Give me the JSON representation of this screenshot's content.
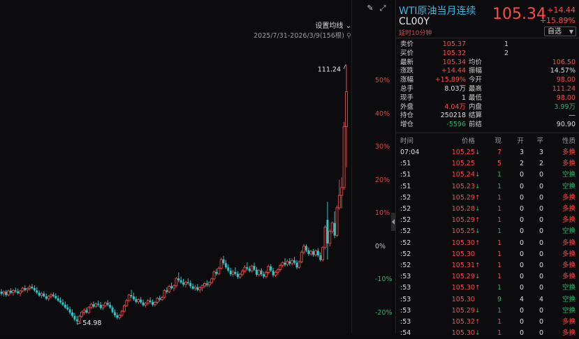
{
  "chart": {
    "toolbar": {
      "draw_icon": "pencil-icon",
      "fullscreen_icon": "fullscreen-icon"
    },
    "ma_setting_label": "设置均线",
    "date_range": "2025/7/31-2026/3/9(156根)",
    "pin_icon": "pin-icon",
    "y_ticks": [
      "50%",
      "40%",
      "30%",
      "20%",
      "10%",
      "0%",
      "-10%",
      "-20%"
    ],
    "high_label": "111.24",
    "low_label": "54.98",
    "colors": {
      "up": "#e04848",
      "down": "#2fc4c4"
    }
  },
  "chart_data": {
    "type": "candlestick",
    "date_range": "2025/7/31-2026/3/9",
    "count": 156,
    "ohlc": [
      [
        62.0,
        62.6,
        61.2,
        61.6
      ],
      [
        61.6,
        62.3,
        61.0,
        62.0
      ],
      [
        62.0,
        62.4,
        60.9,
        61.3
      ],
      [
        61.3,
        62.5,
        61.0,
        62.2
      ],
      [
        62.2,
        62.8,
        61.5,
        61.8
      ],
      [
        61.8,
        62.6,
        61.2,
        62.3
      ],
      [
        62.3,
        62.9,
        61.8,
        62.1
      ],
      [
        62.1,
        62.7,
        61.4,
        61.7
      ],
      [
        61.7,
        62.4,
        61.0,
        62.2
      ],
      [
        62.2,
        63.1,
        61.9,
        62.8
      ],
      [
        62.8,
        63.4,
        62.1,
        62.4
      ],
      [
        62.4,
        63.0,
        61.8,
        62.7
      ],
      [
        62.7,
        63.5,
        62.3,
        63.1
      ],
      [
        63.1,
        63.7,
        62.5,
        62.8
      ],
      [
        62.8,
        63.4,
        62.0,
        62.3
      ],
      [
        62.3,
        63.0,
        61.5,
        61.8
      ],
      [
        61.8,
        62.3,
        60.9,
        61.2
      ],
      [
        61.2,
        62.0,
        60.6,
        61.6
      ],
      [
        61.6,
        62.1,
        60.8,
        61.0
      ],
      [
        61.0,
        61.6,
        60.2,
        60.5
      ],
      [
        60.5,
        61.3,
        60.0,
        61.0
      ],
      [
        61.0,
        61.8,
        60.6,
        61.4
      ],
      [
        61.4,
        61.9,
        60.8,
        61.1
      ],
      [
        61.1,
        61.7,
        60.3,
        60.6
      ],
      [
        60.6,
        61.2,
        59.8,
        60.1
      ],
      [
        60.1,
        60.8,
        59.4,
        59.7
      ],
      [
        59.7,
        60.4,
        58.9,
        59.2
      ],
      [
        59.2,
        59.9,
        58.3,
        58.6
      ],
      [
        58.6,
        59.3,
        57.9,
        58.2
      ],
      [
        58.2,
        58.8,
        57.1,
        57.5
      ],
      [
        57.5,
        58.2,
        56.4,
        56.8
      ],
      [
        56.8,
        57.4,
        55.6,
        56.0
      ],
      [
        56.0,
        56.8,
        54.98,
        55.6
      ],
      [
        55.6,
        57.0,
        55.3,
        56.7
      ],
      [
        56.7,
        57.9,
        56.3,
        57.6
      ],
      [
        57.6,
        58.4,
        57.0,
        58.0
      ],
      [
        58.0,
        58.6,
        57.2,
        57.5
      ],
      [
        57.5,
        58.9,
        57.2,
        58.6
      ],
      [
        58.6,
        59.6,
        58.3,
        59.3
      ],
      [
        59.3,
        59.9,
        58.4,
        58.8
      ],
      [
        58.8,
        59.7,
        58.5,
        59.4
      ],
      [
        59.4,
        60.1,
        58.8,
        59.2
      ],
      [
        59.2,
        59.8,
        58.1,
        58.5
      ],
      [
        58.5,
        59.3,
        58.0,
        59.0
      ],
      [
        59.0,
        59.9,
        58.7,
        59.6
      ],
      [
        59.6,
        60.2,
        58.9,
        59.2
      ],
      [
        59.2,
        59.8,
        58.3,
        58.6
      ],
      [
        58.6,
        59.0,
        57.3,
        57.6
      ],
      [
        57.6,
        58.2,
        56.5,
        56.9
      ],
      [
        56.9,
        57.5,
        56.0,
        56.4
      ],
      [
        56.4,
        57.2,
        56.0,
        56.9
      ],
      [
        56.9,
        58.1,
        56.6,
        57.8
      ],
      [
        57.8,
        59.3,
        57.5,
        59.0
      ],
      [
        59.0,
        60.4,
        58.7,
        60.1
      ],
      [
        60.1,
        61.6,
        59.8,
        61.3
      ],
      [
        61.3,
        62.4,
        60.6,
        61.0
      ],
      [
        61.0,
        61.8,
        60.1,
        60.4
      ],
      [
        60.4,
        61.0,
        59.5,
        59.8
      ],
      [
        59.8,
        60.6,
        59.3,
        60.3
      ],
      [
        60.3,
        60.9,
        59.4,
        59.7
      ],
      [
        59.7,
        60.3,
        58.8,
        59.1
      ],
      [
        59.1,
        59.8,
        58.6,
        59.5
      ],
      [
        59.5,
        60.4,
        59.1,
        60.1
      ],
      [
        60.1,
        60.8,
        59.4,
        59.8
      ],
      [
        59.8,
        60.3,
        58.9,
        59.2
      ],
      [
        59.2,
        60.0,
        58.8,
        59.7
      ],
      [
        59.7,
        60.9,
        59.4,
        60.6
      ],
      [
        60.6,
        61.2,
        59.9,
        60.3
      ],
      [
        60.3,
        61.1,
        60.0,
        60.8
      ],
      [
        60.8,
        62.6,
        60.5,
        62.3
      ],
      [
        62.3,
        63.0,
        61.6,
        62.0
      ],
      [
        62.0,
        63.5,
        61.7,
        63.2
      ],
      [
        63.2,
        64.0,
        62.5,
        62.8
      ],
      [
        62.8,
        63.6,
        62.1,
        63.3
      ],
      [
        63.3,
        65.2,
        63.0,
        64.9
      ],
      [
        64.9,
        66.2,
        64.1,
        64.5
      ],
      [
        64.5,
        65.3,
        63.7,
        64.0
      ],
      [
        64.0,
        64.8,
        63.2,
        63.6
      ],
      [
        63.6,
        64.4,
        62.9,
        64.1
      ],
      [
        64.1,
        64.9,
        63.5,
        63.9
      ],
      [
        63.9,
        64.5,
        62.8,
        63.2
      ],
      [
        63.2,
        63.8,
        62.4,
        62.7
      ],
      [
        62.7,
        63.5,
        62.2,
        63.0
      ],
      [
        63.0,
        63.7,
        62.1,
        62.4
      ],
      [
        62.4,
        63.2,
        61.8,
        62.9
      ],
      [
        62.9,
        63.6,
        62.2,
        63.3
      ],
      [
        63.3,
        64.1,
        62.8,
        63.8
      ],
      [
        63.8,
        64.5,
        63.1,
        63.5
      ],
      [
        63.5,
        64.3,
        63.0,
        64.0
      ],
      [
        64.0,
        65.1,
        63.7,
        64.8
      ],
      [
        64.8,
        66.6,
        64.5,
        66.3
      ],
      [
        66.3,
        67.0,
        65.5,
        65.9
      ],
      [
        65.9,
        67.5,
        65.6,
        67.1
      ],
      [
        67.1,
        69.4,
        66.8,
        69.0
      ],
      [
        69.0,
        69.8,
        67.8,
        68.2
      ],
      [
        68.2,
        68.9,
        66.9,
        67.3
      ],
      [
        67.3,
        68.0,
        66.2,
        66.6
      ],
      [
        66.6,
        67.2,
        65.4,
        65.8
      ],
      [
        65.8,
        66.8,
        65.3,
        66.3
      ],
      [
        66.3,
        67.3,
        65.5,
        65.9
      ],
      [
        65.9,
        66.5,
        64.8,
        65.2
      ],
      [
        65.2,
        66.1,
        64.8,
        65.8
      ],
      [
        65.8,
        66.9,
        65.4,
        66.5
      ],
      [
        66.5,
        67.7,
        66.1,
        67.3
      ],
      [
        67.3,
        68.4,
        66.6,
        67.0
      ],
      [
        67.0,
        67.6,
        66.2,
        66.5
      ],
      [
        66.5,
        67.9,
        66.2,
        67.6
      ],
      [
        67.6,
        68.3,
        66.5,
        66.8
      ],
      [
        66.8,
        67.4,
        65.3,
        65.7
      ],
      [
        65.7,
        66.9,
        65.3,
        66.6
      ],
      [
        66.6,
        67.1,
        65.4,
        65.8
      ],
      [
        65.8,
        66.4,
        64.9,
        65.3
      ],
      [
        65.3,
        66.6,
        64.9,
        66.2
      ],
      [
        66.2,
        67.9,
        65.8,
        67.5
      ],
      [
        67.5,
        68.0,
        66.3,
        66.6
      ],
      [
        66.6,
        67.2,
        65.2,
        65.6
      ],
      [
        65.6,
        66.6,
        65.2,
        66.2
      ],
      [
        66.2,
        67.1,
        65.7,
        66.8
      ],
      [
        66.8,
        68.1,
        66.4,
        67.7
      ],
      [
        67.7,
        68.6,
        67.3,
        68.3
      ],
      [
        68.3,
        69.3,
        67.5,
        67.9
      ],
      [
        67.9,
        69.0,
        67.5,
        68.6
      ],
      [
        68.6,
        69.3,
        67.7,
        68.1
      ],
      [
        68.1,
        69.2,
        67.7,
        68.8
      ],
      [
        68.8,
        69.6,
        67.9,
        68.3
      ],
      [
        68.3,
        68.9,
        66.9,
        67.3
      ],
      [
        67.3,
        68.8,
        67.0,
        68.5
      ],
      [
        68.5,
        71.0,
        68.2,
        70.6
      ],
      [
        70.6,
        72.4,
        70.1,
        71.9
      ],
      [
        71.9,
        72.3,
        70.6,
        71.0
      ],
      [
        71.0,
        71.6,
        69.8,
        70.2
      ],
      [
        70.2,
        71.1,
        69.8,
        70.8
      ],
      [
        70.8,
        71.3,
        69.6,
        70.0
      ],
      [
        70.0,
        71.2,
        69.6,
        70.9
      ],
      [
        70.9,
        71.5,
        69.5,
        69.9
      ],
      [
        69.9,
        70.5,
        68.6,
        68.9
      ],
      [
        68.9,
        71.9,
        68.6,
        71.6
      ],
      [
        71.6,
        76.4,
        71.2,
        76.0
      ],
      [
        77.6,
        81.5,
        69.0,
        72.5
      ],
      [
        72.5,
        75.6,
        71.8,
        75.1
      ],
      [
        75.1,
        77.3,
        74.6,
        76.9
      ],
      [
        76.9,
        79.4,
        73.6,
        74.2
      ],
      [
        74.2,
        80.7,
        73.9,
        80.2
      ],
      [
        80.2,
        86.3,
        79.8,
        82.9
      ],
      [
        82.9,
        86.8,
        80.1,
        84.6
      ],
      [
        84.6,
        98.8,
        84.1,
        97.8
      ],
      [
        97.8,
        111.24,
        89.0,
        105.34
      ]
    ],
    "percent_axis_ticks": [
      "50%",
      "40%",
      "30%",
      "20%",
      "10%",
      "0%",
      "-10%",
      "-20%"
    ],
    "percent_base": 71.8,
    "ylim": [
      52.5,
      115
    ],
    "annotations": {
      "high": 111.24,
      "low": 54.98
    }
  },
  "panel": {
    "instrument_name": "WTI原油当月连续",
    "instrument_code": "CL00Y",
    "delay_note": "延时10分钟",
    "last_price": "105.34",
    "change_abs": "+14.44",
    "change_pct": "+15.89%",
    "watch_button": "自选",
    "quote": [
      {
        "label": "卖价",
        "value": "105.37",
        "value_color": "red",
        "qty": "1",
        "label2": "",
        "value2": "",
        "value2_color": "white"
      },
      {
        "label": "买价",
        "value": "105.32",
        "value_color": "red",
        "qty": "2",
        "label2": "",
        "value2": "",
        "value2_color": "white"
      },
      {
        "label": "最新",
        "value": "105.34",
        "value_color": "red",
        "qty": "",
        "label2": "均价",
        "value2": "106.50",
        "value2_color": "red"
      },
      {
        "label": "涨跌",
        "value": "+14.44",
        "value_color": "red",
        "qty": "",
        "label2": "振幅",
        "value2": "14.57%",
        "value2_color": "white"
      },
      {
        "label": "涨幅",
        "value": "+15.89%",
        "value_color": "red",
        "qty": "",
        "label2": "今开",
        "value2": "98.00",
        "value2_color": "red"
      },
      {
        "label": "总手",
        "value": "8.03万",
        "value_color": "white",
        "qty": "",
        "label2": "最高",
        "value2": "111.24",
        "value2_color": "red"
      },
      {
        "label": "现手",
        "value": "1",
        "value_color": "white",
        "qty": "",
        "label2": "最低",
        "value2": "98.00",
        "value2_color": "red"
      },
      {
        "label": "外盘",
        "value": "4.04万",
        "value_color": "red",
        "qty": "",
        "label2": "内盘",
        "value2": "3.99万",
        "value2_color": "green"
      },
      {
        "label": "持仓",
        "value": "250218",
        "value_color": "white",
        "qty": "",
        "label2": "结算",
        "value2": "—",
        "value2_color": "white"
      },
      {
        "label": "增仓",
        "value": "-5596",
        "value_color": "green",
        "qty": "",
        "label2": "前结",
        "value2": "90.90",
        "value2_color": "white"
      }
    ],
    "tick_headers": {
      "time": "时间",
      "price": "价格",
      "vol": "现",
      "open": "开",
      "close": "平",
      "nature": "性质"
    },
    "ticks": [
      {
        "time": "07:04",
        "price": "105.25",
        "dir": "down",
        "vol": "7",
        "open": "3",
        "close": "3",
        "nature": "多换",
        "nature_color": "red"
      },
      {
        "time": ":51",
        "price": "105.25",
        "dir": "",
        "vol": "5",
        "open": "2",
        "close": "2",
        "nature": "多换",
        "nature_color": "red"
      },
      {
        "time": ":51",
        "price": "105.24",
        "dir": "down",
        "vol": "1",
        "open": "0",
        "close": "0",
        "nature": "空换",
        "nature_color": "green"
      },
      {
        "time": ":51",
        "price": "105.23",
        "dir": "down",
        "vol": "1",
        "open": "0",
        "close": "0",
        "nature": "空换",
        "nature_color": "green"
      },
      {
        "time": ":52",
        "price": "105.29",
        "dir": "up",
        "vol": "1",
        "open": "0",
        "close": "0",
        "nature": "多换",
        "nature_color": "red"
      },
      {
        "time": ":52",
        "price": "105.28",
        "dir": "down",
        "vol": "1",
        "open": "0",
        "close": "0",
        "nature": "多换",
        "nature_color": "red"
      },
      {
        "time": ":52",
        "price": "105.29",
        "dir": "up",
        "vol": "1",
        "open": "0",
        "close": "0",
        "nature": "多换",
        "nature_color": "red"
      },
      {
        "time": ":52",
        "price": "105.25",
        "dir": "down",
        "vol": "1",
        "open": "0",
        "close": "0",
        "nature": "空换",
        "nature_color": "green"
      },
      {
        "time": ":52",
        "price": "105.30",
        "dir": "up",
        "vol": "1",
        "open": "0",
        "close": "0",
        "nature": "多换",
        "nature_color": "red"
      },
      {
        "time": ":52",
        "price": "105.30",
        "dir": "",
        "vol": "1",
        "open": "0",
        "close": "0",
        "nature": "多换",
        "nature_color": "red"
      },
      {
        "time": ":52",
        "price": "105.31",
        "dir": "up",
        "vol": "1",
        "open": "0",
        "close": "0",
        "nature": "多换",
        "nature_color": "red"
      },
      {
        "time": ":53",
        "price": "105.29",
        "dir": "down",
        "vol": "1",
        "open": "0",
        "close": "0",
        "nature": "多换",
        "nature_color": "red"
      },
      {
        "time": ":53",
        "price": "105.30",
        "dir": "up",
        "vol": "1",
        "open": "0",
        "close": "0",
        "nature": "空换",
        "nature_color": "green"
      },
      {
        "time": ":53",
        "price": "105.30",
        "dir": "",
        "vol": "9",
        "open": "4",
        "close": "4",
        "nature": "空换",
        "nature_color": "green"
      },
      {
        "time": ":53",
        "price": "105.29",
        "dir": "down",
        "vol": "1",
        "open": "0",
        "close": "0",
        "nature": "空换",
        "nature_color": "green"
      },
      {
        "time": ":53",
        "price": "105.32",
        "dir": "up",
        "vol": "1",
        "open": "0",
        "close": "0",
        "nature": "多换",
        "nature_color": "red"
      },
      {
        "time": ":54",
        "price": "105.30",
        "dir": "down",
        "vol": "1",
        "open": "0",
        "close": "0",
        "nature": "多换",
        "nature_color": "red"
      }
    ]
  }
}
